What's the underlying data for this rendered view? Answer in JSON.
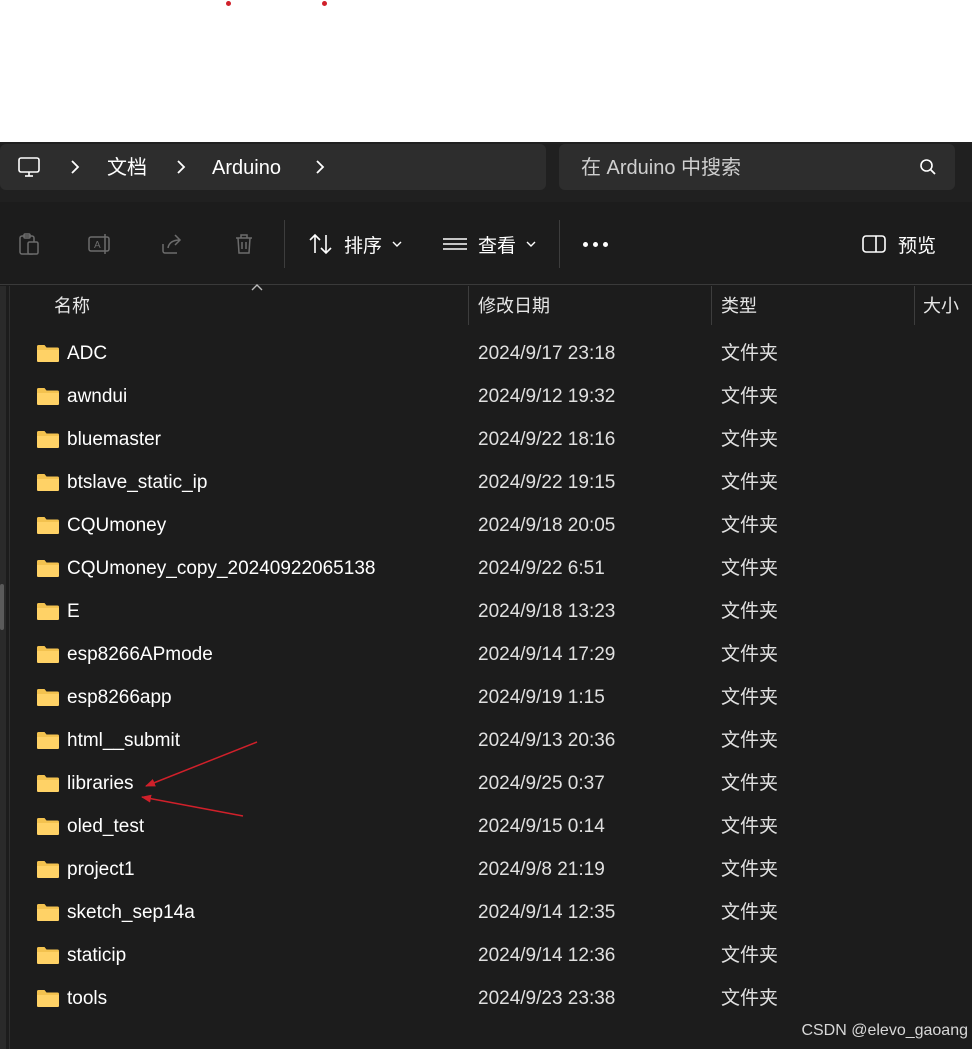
{
  "address": {
    "icon": "computer-icon",
    "breadcrumbs": [
      "文档",
      "Arduino"
    ]
  },
  "search": {
    "placeholder": "在 Arduino 中搜索",
    "icon": "search-icon"
  },
  "toolbar": {
    "action_icons": [
      "clipboard-icon",
      "rename-icon",
      "share-icon",
      "delete-icon"
    ],
    "sort_label": "排序",
    "view_label": "查看",
    "more_icon": "more-icon",
    "preview_label": "预览"
  },
  "columns": {
    "name": "名称",
    "modified": "修改日期",
    "type": "类型",
    "size": "大小"
  },
  "files": [
    {
      "name": "ADC",
      "modified": "2024/9/17 23:18",
      "type": "文件夹"
    },
    {
      "name": "awndui",
      "modified": "2024/9/12 19:32",
      "type": "文件夹"
    },
    {
      "name": "bluemaster",
      "modified": "2024/9/22 18:16",
      "type": "文件夹"
    },
    {
      "name": "btslave_static_ip",
      "modified": "2024/9/22 19:15",
      "type": "文件夹"
    },
    {
      "name": "CQUmoney",
      "modified": "2024/9/18 20:05",
      "type": "文件夹"
    },
    {
      "name": "CQUmoney_copy_20240922065138",
      "modified": "2024/9/22 6:51",
      "type": "文件夹"
    },
    {
      "name": "E",
      "modified": "2024/9/18 13:23",
      "type": "文件夹"
    },
    {
      "name": "esp8266APmode",
      "modified": "2024/9/14 17:29",
      "type": "文件夹"
    },
    {
      "name": "esp8266app",
      "modified": "2024/9/19 1:15",
      "type": "文件夹"
    },
    {
      "name": "html__submit",
      "modified": "2024/9/13 20:36",
      "type": "文件夹"
    },
    {
      "name": "libraries",
      "modified": "2024/9/25 0:37",
      "type": "文件夹"
    },
    {
      "name": "oled_test",
      "modified": "2024/9/15 0:14",
      "type": "文件夹"
    },
    {
      "name": "project1",
      "modified": "2024/9/8 21:19",
      "type": "文件夹"
    },
    {
      "name": "sketch_sep14a",
      "modified": "2024/9/14 12:35",
      "type": "文件夹"
    },
    {
      "name": "staticip",
      "modified": "2024/9/14 12:36",
      "type": "文件夹"
    },
    {
      "name": "tools",
      "modified": "2024/9/23 23:38",
      "type": "文件夹"
    }
  ],
  "colors": {
    "background": "#1c1c1c",
    "bar": "#2d2d2d",
    "folder": "#f3c24f",
    "annotation": "#d0202a"
  },
  "watermark": "CSDN @elevo_gaoang"
}
